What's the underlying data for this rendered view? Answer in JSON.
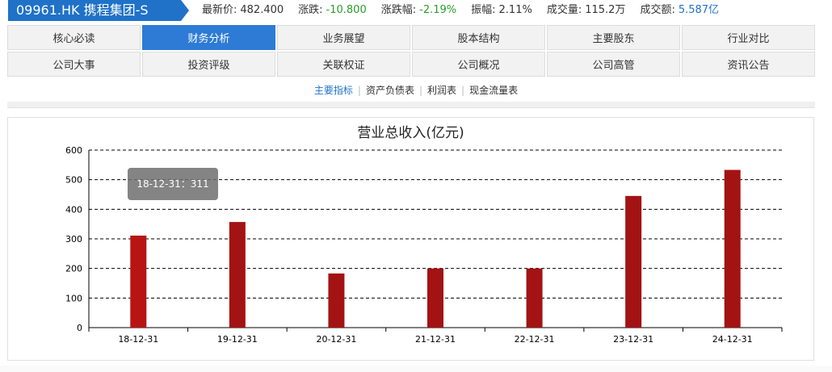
{
  "header": {
    "stock_title": "09961.HK   携程集团-S",
    "fields": [
      {
        "label": "最新价:",
        "value": "482.400",
        "tone": "neutral"
      },
      {
        "label": "涨跌:",
        "value": "-10.800",
        "tone": "down"
      },
      {
        "label": "涨跌幅:",
        "value": "-2.19%",
        "tone": "down"
      },
      {
        "label": "振幅:",
        "value": "2.11%",
        "tone": "neutral"
      },
      {
        "label": "成交量:",
        "value": "115.2万",
        "tone": "neutral"
      },
      {
        "label": "成交额:",
        "value": "5.587亿",
        "tone": "blue"
      }
    ]
  },
  "tabs": [
    {
      "label": "核心必读",
      "active": false
    },
    {
      "label": "财务分析",
      "active": true
    },
    {
      "label": "业务展望",
      "active": false
    },
    {
      "label": "股本结构",
      "active": false
    },
    {
      "label": "主要股东",
      "active": false
    },
    {
      "label": "行业对比",
      "active": false
    },
    {
      "label": "公司大事",
      "active": false
    },
    {
      "label": "投资评级",
      "active": false
    },
    {
      "label": "关联权证",
      "active": false
    },
    {
      "label": "公司概况",
      "active": false
    },
    {
      "label": "公司高管",
      "active": false
    },
    {
      "label": "资讯公告",
      "active": false
    }
  ],
  "subnav": [
    {
      "label": "主要指标",
      "active": true
    },
    {
      "label": "资产负债表",
      "active": false
    },
    {
      "label": "利润表",
      "active": false
    },
    {
      "label": "现金流量表",
      "active": false
    }
  ],
  "tooltip": {
    "text": "18-12-31：311"
  },
  "colors": {
    "accent": "#2e7bd6",
    "bar": "#a31313",
    "bar_highlight": "#b81414"
  },
  "chart_data": {
    "type": "bar",
    "title": "营业总收入(亿元)",
    "categories": [
      "18-12-31",
      "19-12-31",
      "20-12-31",
      "21-12-31",
      "22-12-31",
      "23-12-31",
      "24-12-31"
    ],
    "values": [
      311,
      357,
      183,
      200,
      200,
      445,
      533
    ],
    "ylim": [
      0,
      600
    ],
    "yticks": [
      0,
      100,
      200,
      300,
      400,
      500,
      600
    ],
    "grid": true,
    "xlabel": "",
    "ylabel": ""
  }
}
